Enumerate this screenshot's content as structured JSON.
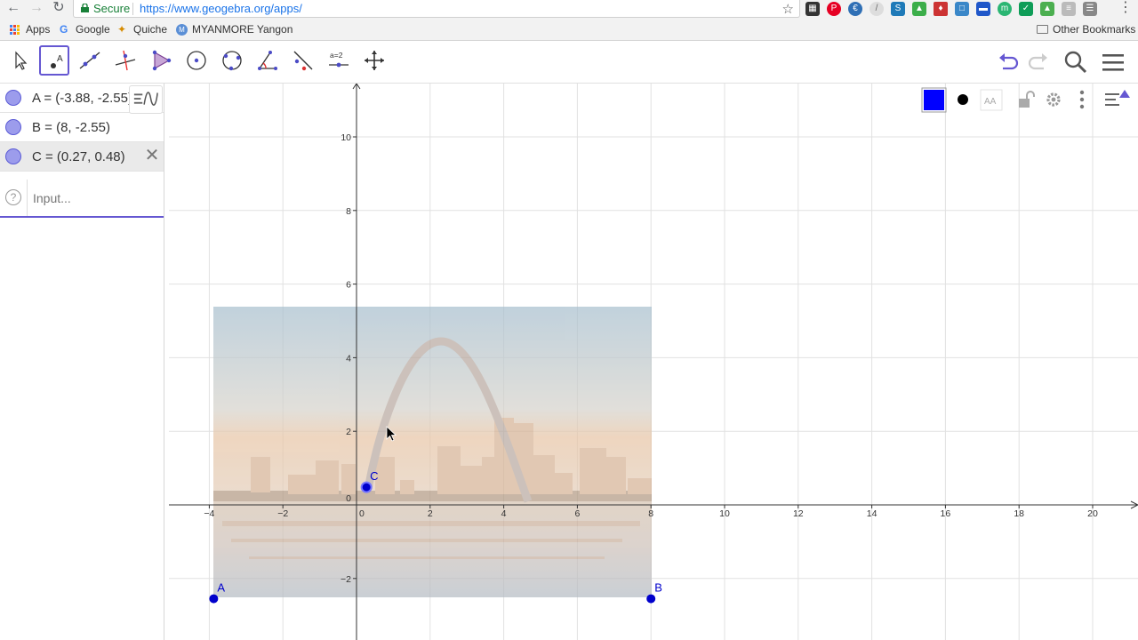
{
  "browser": {
    "secure_label": "Secure",
    "url": "https://www.geogebra.org/apps/",
    "bookmarks": [
      {
        "label": "Apps",
        "icon": "apps-grid-icon"
      },
      {
        "label": "Google",
        "icon": "google-icon"
      },
      {
        "label": "Quiche",
        "icon": "quiche-icon"
      },
      {
        "label": "MYANMORE Yangon",
        "icon": "myanmore-icon"
      }
    ],
    "other_bookmarks": "Other Bookmarks",
    "extension_icons": [
      "qr-code-icon",
      "pinterest-icon",
      "euro-icon",
      "timer-icon",
      "s-icon",
      "image-icon",
      "puzzle-icon",
      "screenshot-icon",
      "monitor-icon",
      "m-icon",
      "tick-icon",
      "drive-icon",
      "grid-icon",
      "evernote-icon"
    ]
  },
  "toolbar": {
    "tools": [
      "move-tool",
      "point-tool",
      "line-tool",
      "perpendicular-line-tool",
      "polygon-tool",
      "circle-center-point-tool",
      "circle-three-points-tool",
      "angle-tool",
      "reflect-tool",
      "slider-tool",
      "move-graphics-view-tool"
    ],
    "selected_tool": "point-tool",
    "slider_label": "a=2",
    "accent": "#6557d2"
  },
  "algebra": {
    "rows": [
      {
        "text": "A = (-3.88, -2.55)"
      },
      {
        "text": "B = (8, -2.55)"
      },
      {
        "text": "C = (0.27, 0.48)"
      }
    ],
    "input_placeholder": "Input..."
  },
  "graphics": {
    "x_ticks": [
      "−4",
      "−2",
      "0",
      "2",
      "4",
      "6",
      "8",
      "10",
      "12",
      "14",
      "16",
      "18",
      "20"
    ],
    "y_ticks": [
      "10",
      "8",
      "6",
      "4",
      "2",
      "0",
      "−2"
    ],
    "points": [
      {
        "name": "A",
        "x": -3.88,
        "y": -2.55
      },
      {
        "name": "B",
        "x": 8,
        "y": -2.55
      },
      {
        "name": "C",
        "x": 0.27,
        "y": 0.48
      }
    ],
    "point_color": "#0000cc",
    "style_color": "#0000ff"
  }
}
